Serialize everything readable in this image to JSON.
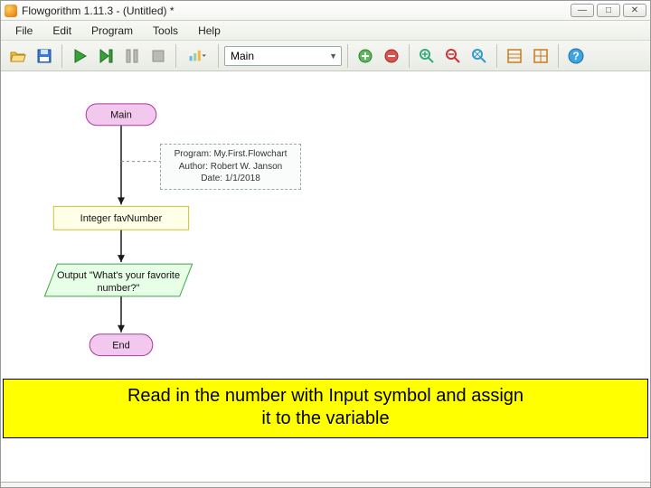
{
  "window": {
    "title": "Flowgorithm 1.11.3 - (Untitled) *",
    "buttons": {
      "min": "—",
      "max": "□",
      "close": "✕"
    }
  },
  "menu": {
    "file": "File",
    "edit": "Edit",
    "program": "Program",
    "tools": "Tools",
    "help": "Help"
  },
  "toolbar": {
    "function_selected": "Main"
  },
  "flowchart": {
    "start": "Main",
    "declare": "Integer favNumber",
    "output_l1": "Output \"What's your favorite",
    "output_l2": "number?\"",
    "end": "End",
    "comment_l1": "Program: My.First.Flowchart",
    "comment_l2": "Author: Robert W. Janson",
    "comment_l3": "Date:   1/1/2018"
  },
  "instruction": {
    "line1": "Read in the number with Input symbol and assign",
    "line2": "it to the variable"
  }
}
